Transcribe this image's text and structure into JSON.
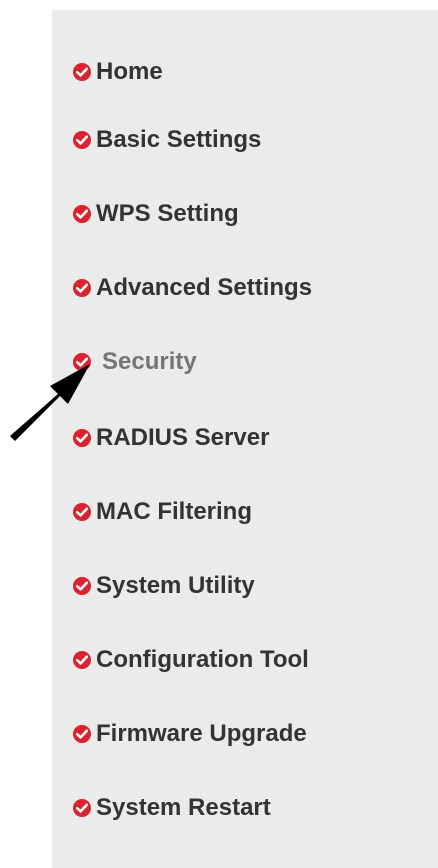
{
  "menu": {
    "accent_color": "#d9232f",
    "items": [
      {
        "id": "home",
        "label": "Home"
      },
      {
        "id": "basic-settings",
        "label": "Basic Settings"
      },
      {
        "id": "wps-setting",
        "label": "WPS Setting"
      },
      {
        "id": "advanced-settings",
        "label": "Advanced Settings"
      },
      {
        "id": "security",
        "label": "Security"
      },
      {
        "id": "radius-server",
        "label": "RADIUS Server"
      },
      {
        "id": "mac-filtering",
        "label": "MAC Filtering"
      },
      {
        "id": "system-utility",
        "label": "System Utility"
      },
      {
        "id": "configuration-tool",
        "label": "Configuration Tool"
      },
      {
        "id": "firmware-upgrade",
        "label": "Firmware Upgrade"
      },
      {
        "id": "system-restart",
        "label": "System Restart"
      }
    ],
    "selected": "Security"
  },
  "icons": {
    "bullet": "check-bullet-icon",
    "pointer": "arrow-pointer-icon"
  }
}
